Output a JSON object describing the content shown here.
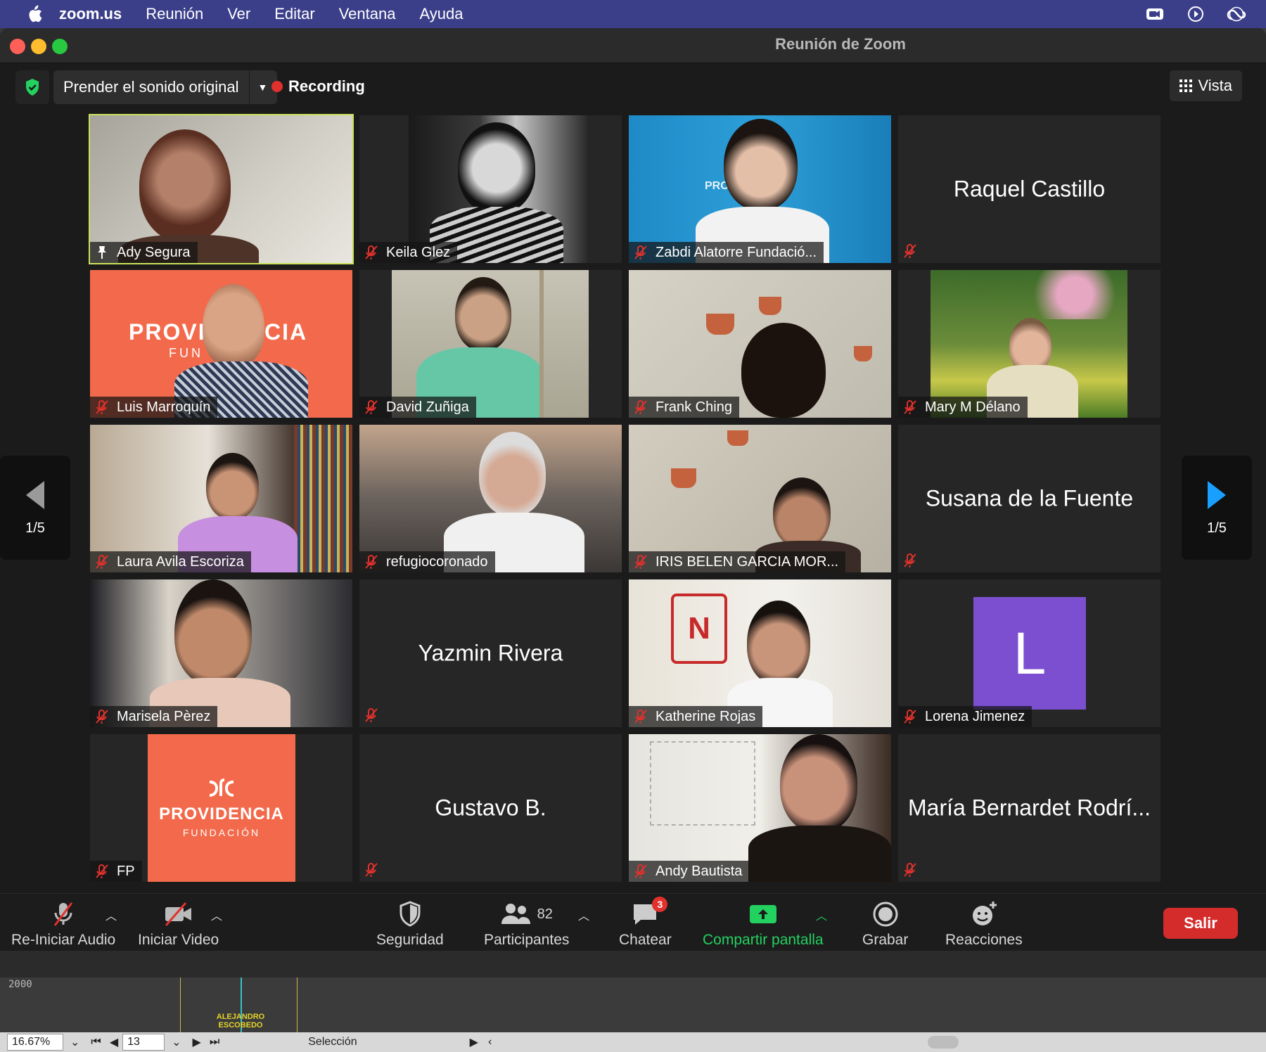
{
  "menubar": {
    "app": "zoom.us",
    "items": [
      "Reunión",
      "Ver",
      "Editar",
      "Ventana",
      "Ayuda"
    ]
  },
  "window": {
    "title": "Reunión de Zoom"
  },
  "topbar": {
    "sound_button": "Prender el sonido original",
    "recording": "Recording",
    "view_button": "Vista"
  },
  "pager": {
    "left": "1/5",
    "right": "1/5"
  },
  "participants": [
    {
      "name": "Ady Segura",
      "video": true
    },
    {
      "name": "Keila Glez",
      "video": true
    },
    {
      "name": "Zabdi Alatorre Fundació...",
      "video": true
    },
    {
      "name": "Raquel Castillo",
      "video": false
    },
    {
      "name": "Luis Marroquín",
      "video": true
    },
    {
      "name": "David Zuñiga",
      "video": true
    },
    {
      "name": "Frank Ching",
      "video": true
    },
    {
      "name": "Mary M Délano",
      "video": true
    },
    {
      "name": "Laura Avila Escoriza",
      "video": true
    },
    {
      "name": "refugiocoronado",
      "video": true
    },
    {
      "name": "IRIS BELEN GARCIA MOR...",
      "video": true
    },
    {
      "name": "Susana de la Fuente",
      "video": false
    },
    {
      "name": "Marisela Pèrez",
      "video": true
    },
    {
      "name": "Yazmin Rivera",
      "video": false
    },
    {
      "name": "Katherine Rojas",
      "video": true
    },
    {
      "name": "Lorena Jimenez",
      "video": false,
      "avatar_letter": "L"
    },
    {
      "name": "FP",
      "video": false,
      "logo": "PROVIDENCIA",
      "logo_sub": "FUNDACIÓN"
    },
    {
      "name": "Gustavo B.",
      "video": false
    },
    {
      "name": "Andy Bautista",
      "video": true
    },
    {
      "name": "María Bernardet Rodrí...",
      "video": false
    }
  ],
  "tile_logo_text": {
    "luis_bg_1": "PROVI",
    "luis_bg_2": "CIA",
    "luis_bg_3": "FUN",
    "zabdi_bg": "PRC"
  },
  "toolbar": {
    "audio": "Re-Iniciar Audio",
    "video": "Iniciar Video",
    "security": "Seguridad",
    "participants": "Participantes",
    "participants_count": "82",
    "chat": "Chatear",
    "chat_badge": "3",
    "share": "Compartir pantalla",
    "record": "Grabar",
    "reactions": "Reacciones",
    "leave": "Salir"
  },
  "editor": {
    "ruler": "2000",
    "clip_name": "ALEJANDRO ESCOBEDO",
    "zoom": "16.67%",
    "frame": "13",
    "mode": "Selección"
  },
  "colors": {
    "active_speaker": "#c8e25a",
    "mute_red": "#e0312c",
    "share_green": "#23d160",
    "leave_red": "#d42b2b",
    "providencia_orange": "#f26a4b",
    "avatar_purple": "#7b4fd0"
  }
}
